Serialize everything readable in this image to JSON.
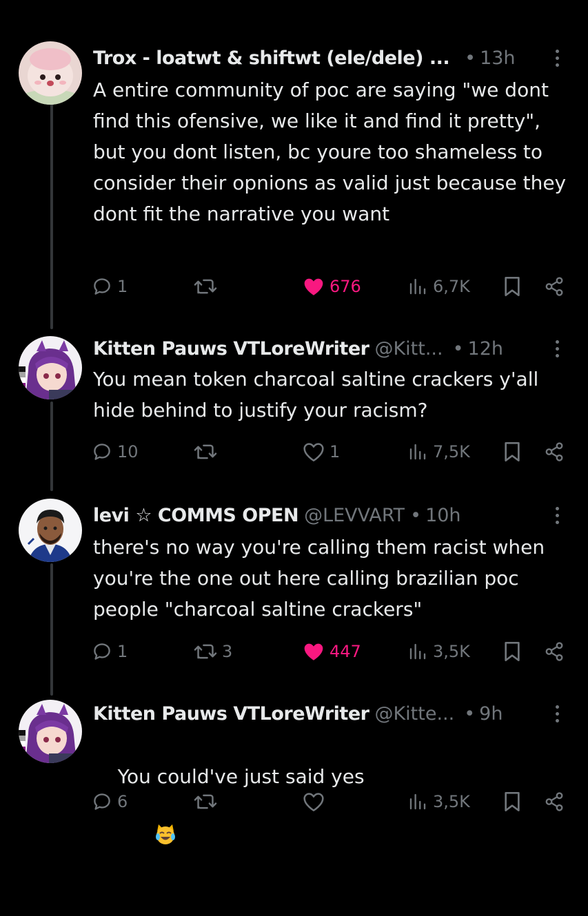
{
  "colors": {
    "background": "#000000",
    "text_primary": "#e7e9ea",
    "text_secondary": "#71767b",
    "like_active": "#f91880",
    "thread_line": "#333639"
  },
  "tweets": [
    {
      "avatar_icon": "pink-plush-avatar",
      "name": "Trox - loatwt & shiftwt (ele/dele) ...",
      "handle": "",
      "time": "13h",
      "text": "A entire community of poc are saying \"we dont find this ofensive, we like it and find it pretty\", but you dont listen, bc youre too shameless to consider their opnions as valid just because they dont fit the narrative you want",
      "replies": "1",
      "retweets": "",
      "likes": "676",
      "liked": true,
      "views": "6,7K"
    },
    {
      "avatar_icon": "anime-catgirl-avatar",
      "name": "Kitten Pauws VTLoreWriter",
      "handle": "@Kitt...",
      "time": "12h",
      "text": "You mean token charcoal saltine crackers y'all hide behind to justify your racism?",
      "replies": "10",
      "retweets": "",
      "likes": "1",
      "liked": false,
      "views": "7,5K"
    },
    {
      "avatar_icon": "man-portrait-avatar",
      "name": "levi ☆ COMMS OPEN",
      "handle": "@LEVVART",
      "time": "10h",
      "text": "there's no way you're calling them racist when you're the one out here calling brazilian poc people \"charcoal saltine crackers\"",
      "replies": "1",
      "retweets": "3",
      "likes": "447",
      "liked": true,
      "views": "3,5K"
    },
    {
      "avatar_icon": "anime-catgirl-avatar",
      "name": "Kitten Pauws VTLoreWriter",
      "handle": "@Kitte...",
      "time": "9h",
      "text": "You could've just said yes",
      "text_emoji": "tears-of-joy-cat-emoji",
      "replies": "6",
      "retweets": "",
      "likes": "",
      "liked": false,
      "views": "3,5K"
    }
  ]
}
